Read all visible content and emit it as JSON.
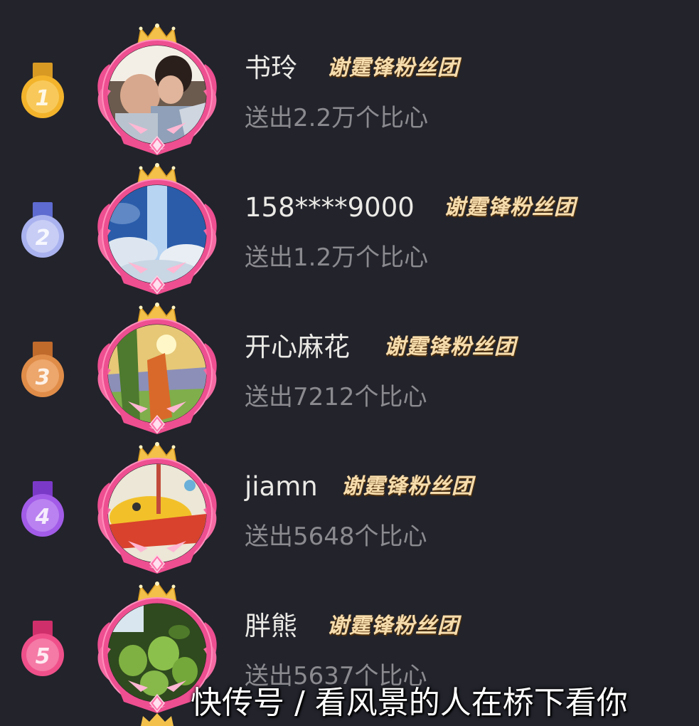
{
  "ranking": [
    {
      "rank": "1",
      "name": "书玲",
      "badge": "谢霆锋粉丝团",
      "sent": "送出2.2万个比心",
      "medal_color": "#f3b42c",
      "avatar_desc": "mother-and-child-photo"
    },
    {
      "rank": "2",
      "name": "158****9000",
      "badge": "谢霆锋粉丝团",
      "sent": "送出1.2万个比心",
      "medal_color": "#8e9be6",
      "avatar_desc": "sky-and-clouds-photo"
    },
    {
      "rank": "3",
      "name": "开心麻花",
      "badge": "谢霆锋粉丝团",
      "sent": "送出7212个比心",
      "medal_color": "#e08d49",
      "avatar_desc": "sun-painting"
    },
    {
      "rank": "4",
      "name": "jiamn",
      "badge": "谢霆锋粉丝团",
      "sent": "送出5648个比心",
      "medal_color": "#a25ce8",
      "avatar_desc": "child-drawing"
    },
    {
      "rank": "5",
      "name": "胖熊",
      "badge": "谢霆锋粉丝团",
      "sent": "送出5637个比心",
      "medal_color": "#f0508a",
      "avatar_desc": "green-fruits-photo"
    }
  ],
  "watermark": "快传号 / 看风景的人在桥下看你",
  "colors": {
    "background": "#22232b",
    "frame_pink": "#ee4f90",
    "crown_gold": "#f3c14a",
    "badge_text": "#f6ddae",
    "sent_text": "#8a8a8f"
  }
}
